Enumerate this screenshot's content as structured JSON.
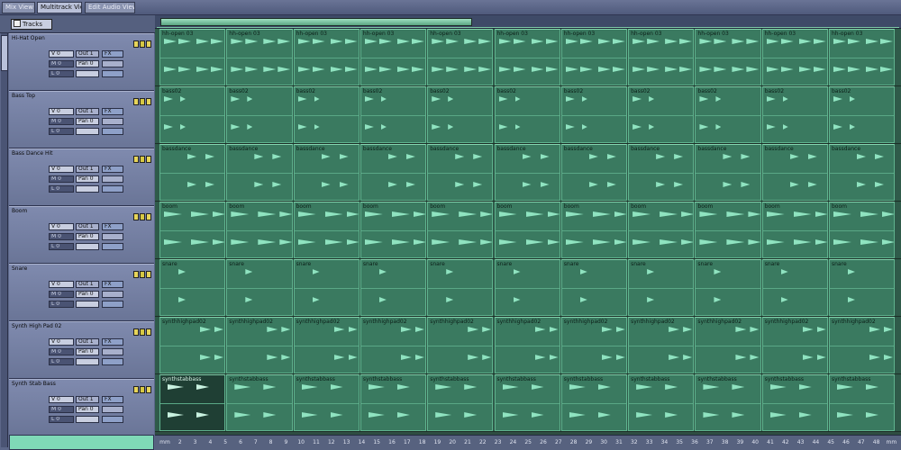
{
  "tabs": [
    {
      "label": "Mix View",
      "active": false
    },
    {
      "label": "Multitrack View",
      "active": true
    },
    {
      "label": "Edit Audio View",
      "active": false
    }
  ],
  "header_button": "Tracks",
  "track_labels": {
    "volume": "V 0",
    "mute": "M 0",
    "pan": "Pan 0",
    "level": "L 0",
    "out": "Out 1",
    "fx": "FX"
  },
  "tracks": [
    {
      "name": "Hi-Hat Open",
      "clip_label": "hh-open 03"
    },
    {
      "name": "Bass Top",
      "clip_label": "bass02"
    },
    {
      "name": "Bass Dance Hit",
      "clip_label": "bassdance"
    },
    {
      "name": "Boom",
      "clip_label": "boom"
    },
    {
      "name": "Snare",
      "clip_label": "snare"
    },
    {
      "name": "Synth High Pad 02",
      "clip_label": "synthhighpad02"
    },
    {
      "name": "Synth Stab Bass",
      "clip_label": "synthstabbass"
    }
  ],
  "ruler": [
    "mm",
    "2",
    "3",
    "4",
    "5",
    "6",
    "7",
    "8",
    "9",
    "10",
    "11",
    "12",
    "13",
    "14",
    "15",
    "16",
    "17",
    "18",
    "19",
    "20",
    "21",
    "22",
    "23",
    "24",
    "25",
    "26",
    "27",
    "28",
    "29",
    "30",
    "31",
    "32",
    "33",
    "34",
    "35",
    "36",
    "37",
    "38",
    "39",
    "40",
    "41",
    "42",
    "43",
    "44",
    "45",
    "46",
    "47",
    "48",
    "mm"
  ],
  "colors": {
    "clip": "#3a7a60",
    "clip_border": "#5fb38e",
    "wave": "#8fe3c0",
    "header": "#7f8aae"
  }
}
